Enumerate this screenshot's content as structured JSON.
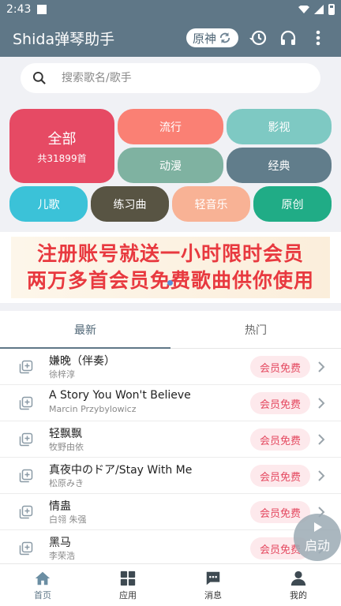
{
  "status": {
    "time": "2:43"
  },
  "app": {
    "title": "Shida弹琴助手",
    "mode_label": "原神"
  },
  "search": {
    "placeholder": "搜索歌名/歌手"
  },
  "categories": {
    "all_label": "全部",
    "all_count": "共31899首",
    "items": [
      {
        "label": "流行",
        "color": "#fa8074"
      },
      {
        "label": "影视",
        "color": "#7ec9c3"
      },
      {
        "label": "动漫",
        "color": "#7fb2a1"
      },
      {
        "label": "经典",
        "color": "#617d8b"
      },
      {
        "label": "儿歌",
        "color": "#3bc2d8"
      },
      {
        "label": "练习曲",
        "color": "#585443"
      },
      {
        "label": "轻音乐",
        "color": "#f8b295"
      },
      {
        "label": "原创",
        "color": "#20ac86"
      }
    ]
  },
  "banner": {
    "line1": "注册账号就送一小时限时会员",
    "line2": "两万多首会员免费歌曲供你使用"
  },
  "tabs": [
    {
      "label": "最新"
    },
    {
      "label": "热门"
    }
  ],
  "songs": [
    {
      "title": "嫌晚（伴奏）",
      "artist": "徐梓淳",
      "badge": "会员免费"
    },
    {
      "title": "A Story You Won't Believe",
      "artist": "Marcin Przybylowicz",
      "badge": "会员免费"
    },
    {
      "title": "轻飘飘",
      "artist": "牧野由依",
      "badge": "会员免费"
    },
    {
      "title": "真夜中のドア/Stay With Me",
      "artist": "松原みき",
      "badge": "会员免费"
    },
    {
      "title": "情蛊",
      "artist": "白翎 朱强",
      "badge": "会员免费"
    },
    {
      "title": "黑马",
      "artist": "李荣浩",
      "badge": "会员免费"
    }
  ],
  "fab": {
    "label": "启动"
  },
  "nav": [
    {
      "label": "首页",
      "icon": "home-icon"
    },
    {
      "label": "应用",
      "icon": "apps-icon"
    },
    {
      "label": "消息",
      "icon": "message-icon"
    },
    {
      "label": "我的",
      "icon": "person-icon"
    }
  ],
  "colors": {
    "primary": "#5f7787",
    "vip": "#e4485f",
    "all_category": "#e64a64"
  }
}
